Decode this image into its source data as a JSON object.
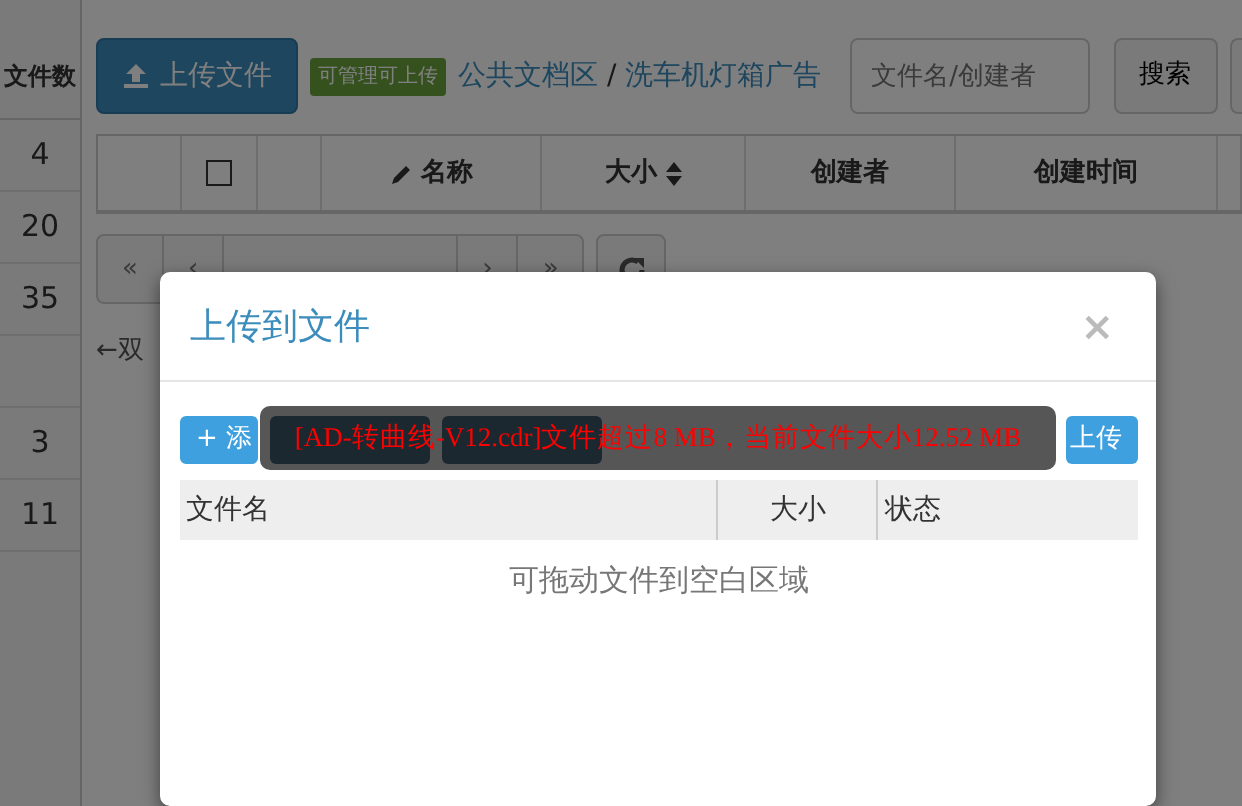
{
  "left_column": {
    "header": "文件数",
    "rows": [
      {
        "count": "4"
      },
      {
        "count": "20"
      },
      {
        "count": "35"
      },
      {},
      {
        "count": "3"
      },
      {
        "count": "11"
      }
    ]
  },
  "toolbar": {
    "upload_button": "上传文件",
    "permission_badge": "可管理可上传",
    "breadcrumb": [
      "公共文档区",
      "洗车机灯箱广告"
    ],
    "breadcrumb_separator": "/",
    "search": {
      "placeholder": "文件名/创建者"
    },
    "search_button": "搜索"
  },
  "table": {
    "columns": [
      {
        "kind": "blank"
      },
      {
        "kind": "checkbox",
        "checked": false
      },
      {
        "kind": "blank"
      },
      {
        "kind": "edit",
        "label": "名称"
      },
      {
        "kind": "sortable",
        "label": "大小"
      },
      {
        "kind": "text",
        "label": "创建者"
      },
      {
        "kind": "text",
        "label": "创建时间"
      },
      {
        "kind": "blank"
      }
    ]
  },
  "pagination": {
    "buttons": [
      {
        "label": "«"
      },
      {
        "label": "‹"
      },
      {
        "kind": "page_info"
      },
      {
        "label": "›"
      },
      {
        "label": "»"
      }
    ]
  },
  "hint": "←双",
  "modal": {
    "title": "上传到文件",
    "close": "×",
    "buttons": [
      {
        "kind": "primary",
        "label": "+ 添"
      },
      {
        "kind": "secondary"
      },
      {
        "kind": "secondary"
      },
      {
        "kind": "primary",
        "label": "上传"
      }
    ],
    "toast": "[AD-转曲线-V12.cdr]文件超过8 MB，当前文件大小12.52 MB",
    "file_table": {
      "columns": [
        "文件名",
        "大小",
        "状态"
      ],
      "empty_text": "可拖动文件到空白区域"
    }
  }
}
